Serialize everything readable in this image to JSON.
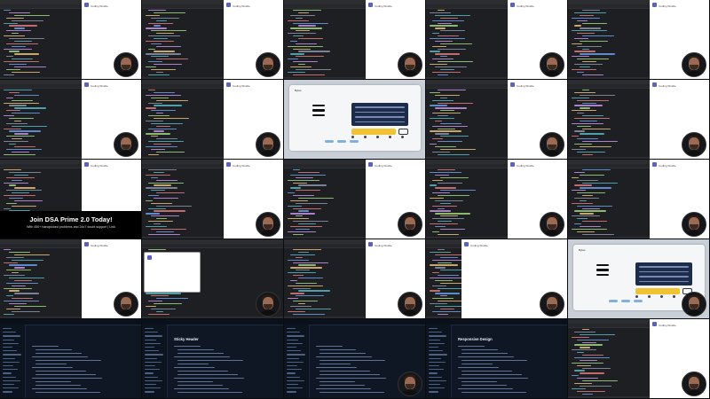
{
  "app": {
    "preview_tab_title": "Coding Shuttle",
    "menu_app_title": "Bytes"
  },
  "promo": {
    "title": "Join DSA Prime 2.0 Today!",
    "subtitle": "With 450+ handpicked problems and 24x7 doubt support | Link"
  },
  "docs": {
    "heading_left": "Sticky Header",
    "heading_right": "Responsive Design"
  },
  "colors": {
    "editor_bg": "#1e1f22",
    "preview_bg": "#ffffff",
    "accent_yellow": "#f1c232",
    "menu_navy": "#1d2c4a",
    "docs_bg": "#0f1724"
  },
  "icons": [
    "hamburger-icon",
    "favicon-icon"
  ],
  "tiles": [
    {
      "kind": "editor-preview"
    },
    {
      "kind": "preview-only"
    },
    {
      "kind": "editor-preview"
    },
    {
      "kind": "editor-preview"
    },
    {
      "kind": "editor-preview"
    },
    {
      "kind": "editor-preview"
    },
    {
      "kind": "editor-preview"
    },
    {
      "kind": "menu-app"
    },
    {
      "kind": "editor-preview"
    },
    {
      "kind": "editor-preview"
    },
    {
      "kind": "promo"
    },
    {
      "kind": "editor-preview"
    },
    {
      "kind": "editor-preview"
    },
    {
      "kind": "editor-preview"
    },
    {
      "kind": "editor-preview"
    },
    {
      "kind": "editor-preview"
    },
    {
      "kind": "popup"
    },
    {
      "kind": "editor-preview"
    },
    {
      "kind": "preview-cam"
    },
    {
      "kind": "menu-app-wide"
    },
    {
      "kind": "docs-left"
    },
    {
      "kind": "docs-left2"
    },
    {
      "kind": "docs-right"
    },
    {
      "kind": "docs-right2"
    },
    {
      "kind": "editor-preview"
    }
  ]
}
